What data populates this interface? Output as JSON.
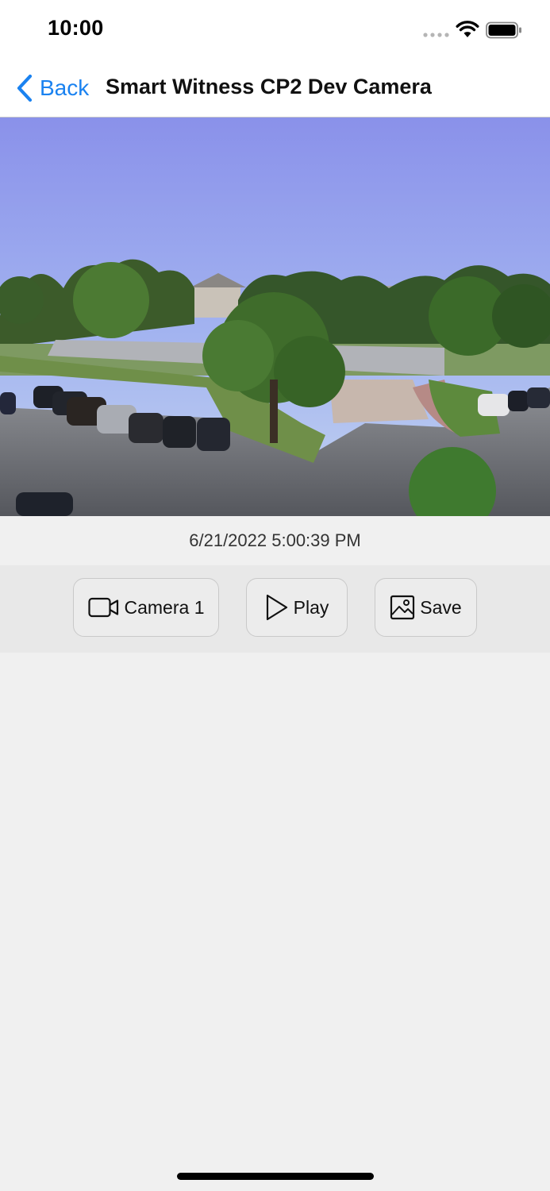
{
  "status_bar": {
    "time": "10:00",
    "icons": [
      "signal-icon",
      "wifi-icon",
      "battery-icon"
    ]
  },
  "nav": {
    "back_label": "Back",
    "title": "Smart Witness CP2 Dev Camera"
  },
  "camera": {
    "timestamp": "6/21/2022 5:00:39 PM"
  },
  "toolbar": {
    "camera_label": "Camera 1",
    "play_label": "Play",
    "save_label": "Save",
    "camera_icon": "video-camera-icon",
    "play_icon": "play-icon",
    "save_icon": "image-icon"
  },
  "colors": {
    "accent": "#1a82f0",
    "background": "#f0f0f0",
    "toolbar": "#e8e8e8"
  }
}
